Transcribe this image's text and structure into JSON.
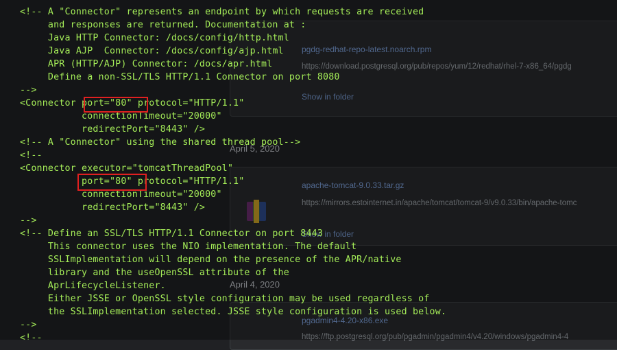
{
  "downloads": {
    "date_1": "April 5, 2020",
    "date_2": "April 4, 2020",
    "items": [
      {
        "name": "pgdg-redhat-repo-latest.noarch.rpm",
        "url": "https://download.postgresql.org/pub/repos/yum/12/redhat/rhel-7-x86_64/pgdg",
        "link": "Show in folder"
      },
      {
        "name": "apache-tomcat-9.0.33.tar.gz",
        "url": "https://mirrors.estointernet.in/apache/tomcat/tomcat-9/v9.0.33/bin/apache-tomc",
        "link": "Show in folder"
      },
      {
        "name": "pgadmin4-4.20-x86.exe",
        "url": "https://ftp.postgresql.org/pub/pgadmin/pgadmin4/v4.20/windows/pgadmin4-4",
        "link": ""
      }
    ]
  },
  "code": {
    "lines": [
      "<!-- A \"Connector\" represents an endpoint by which requests are received",
      "     and responses are returned. Documentation at :",
      "     Java HTTP Connector: /docs/config/http.html",
      "     Java AJP  Connector: /docs/config/ajp.html",
      "     APR (HTTP/AJP) Connector: /docs/apr.html",
      "     Define a non-SSL/TLS HTTP/1.1 Connector on port 8080",
      "-->",
      "<Connector port=\"80\" protocol=\"HTTP/1.1\"",
      "           connectionTimeout=\"20000\"",
      "           redirectPort=\"8443\" />",
      "<!-- A \"Connector\" using the shared thread pool-->",
      "<!--",
      "<Connector executor=\"tomcatThreadPool\"",
      "           port=\"80\" protocol=\"HTTP/1.1\"",
      "           connectionTimeout=\"20000\"",
      "           redirectPort=\"8443\" />",
      "-->",
      "<!-- Define an SSL/TLS HTTP/1.1 Connector on port 8443",
      "     This connector uses the NIO implementation. The default",
      "     SSLImplementation will depend on the presence of the APR/native",
      "     library and the useOpenSSL attribute of the",
      "     AprLifecycleListener.",
      "     Either JSSE or OpenSSL style configuration may be used regardless of",
      "     the SSLImplementation selected. JSSE style configuration is used below.",
      "-->",
      "<!--"
    ]
  },
  "colors": {
    "code_text": "#a4ec58",
    "highlight_box": "#e02020",
    "background": "#202124"
  }
}
